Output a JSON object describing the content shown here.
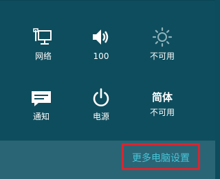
{
  "tiles": [
    {
      "id": "network",
      "label": "网络",
      "icon": "network-icon"
    },
    {
      "id": "volume",
      "label": "100",
      "icon": "volume-icon"
    },
    {
      "id": "brightness",
      "label": "不可用",
      "icon": "brightness-icon"
    },
    {
      "id": "notifications",
      "label": "通知",
      "icon": "notifications-icon"
    },
    {
      "id": "power",
      "label": "电源",
      "icon": "power-icon"
    },
    {
      "id": "keyboard",
      "label": "不可用",
      "big_text": "简体",
      "icon": "keyboard-text-icon"
    }
  ],
  "footer": {
    "link_label": "更多电脑设置"
  },
  "colors": {
    "background": "#0e4d5d",
    "footer_background": "#2a6576",
    "link": "#46c6d8",
    "highlight_border": "#d8262f",
    "icon": "#ffffff"
  }
}
